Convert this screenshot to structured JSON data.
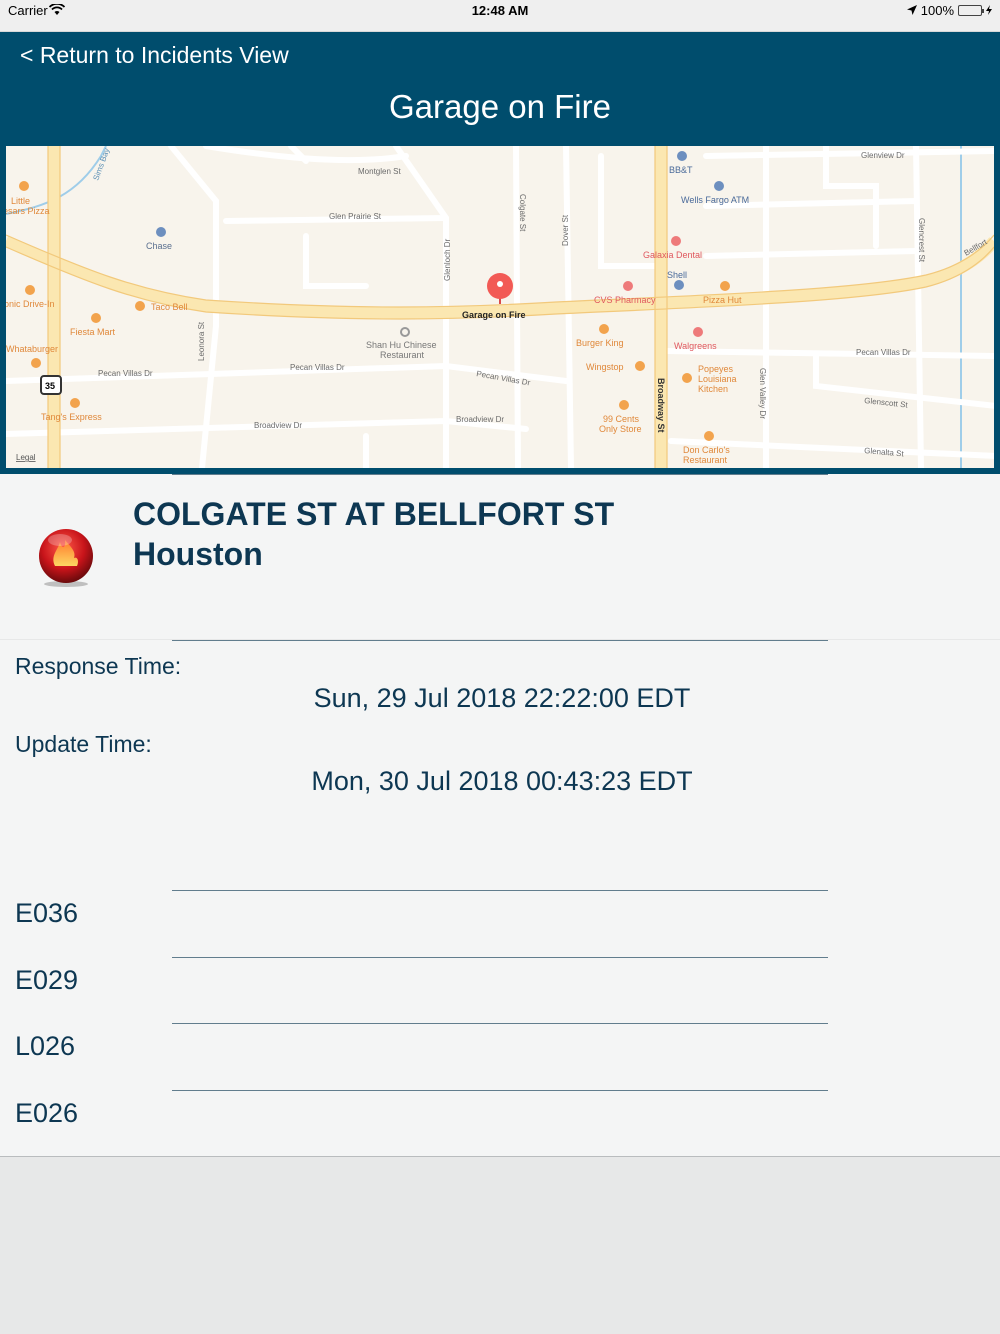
{
  "status_bar": {
    "carrier": "Carrier",
    "time": "12:48 AM",
    "battery": "100%"
  },
  "header": {
    "back_label": "< Return to Incidents View",
    "title": "Garage on Fire"
  },
  "map": {
    "pin_label": "Garage on Fire",
    "legal": "Legal",
    "highway_shield": "35",
    "streets": [
      "Montglen St",
      "Glen Prairie St",
      "Glenview Dr",
      "Colgate St",
      "Dover St",
      "Glenloch Dr",
      "Leonora St",
      "Pecan Villas Dr",
      "Broadview Dr",
      "Broadway St",
      "Glen Valley Dr",
      "Glenscott St",
      "Glenalta St",
      "Glencrest St",
      "Bellfort",
      "Sims Bay"
    ],
    "places": [
      "Little Caesars Pizza",
      "Chase",
      "BB&T",
      "Wells Fargo ATM",
      "Galaxia Dental",
      "Shell",
      "CVS Pharmacy",
      "Pizza Hut",
      "Taco Bell",
      "Sonic Drive-In",
      "Fiesta Mart",
      "Whataburger",
      "Shan Hu Chinese Restaurant",
      "Burger King",
      "Walgreens",
      "Wingstop",
      "Popeyes Louisiana Kitchen",
      "Tang's Express",
      "99 Cents Only Store",
      "Don Carlo's Restaurant"
    ]
  },
  "incident": {
    "street": "COLGATE ST AT BELLFORT ST",
    "city": "Houston",
    "icon": "fire-icon"
  },
  "times": {
    "response_label": "Response Time:",
    "response_value": "Sun, 29 Jul 2018 22:22:00 EDT",
    "update_label": "Update Time:",
    "update_value": "Mon, 30 Jul 2018 00:43:23 EDT"
  },
  "units": [
    "E036",
    "E029",
    "L026",
    "E026"
  ],
  "colors": {
    "header": "#004d6d",
    "text": "#0d3752",
    "panel": "#f4f5f5"
  }
}
